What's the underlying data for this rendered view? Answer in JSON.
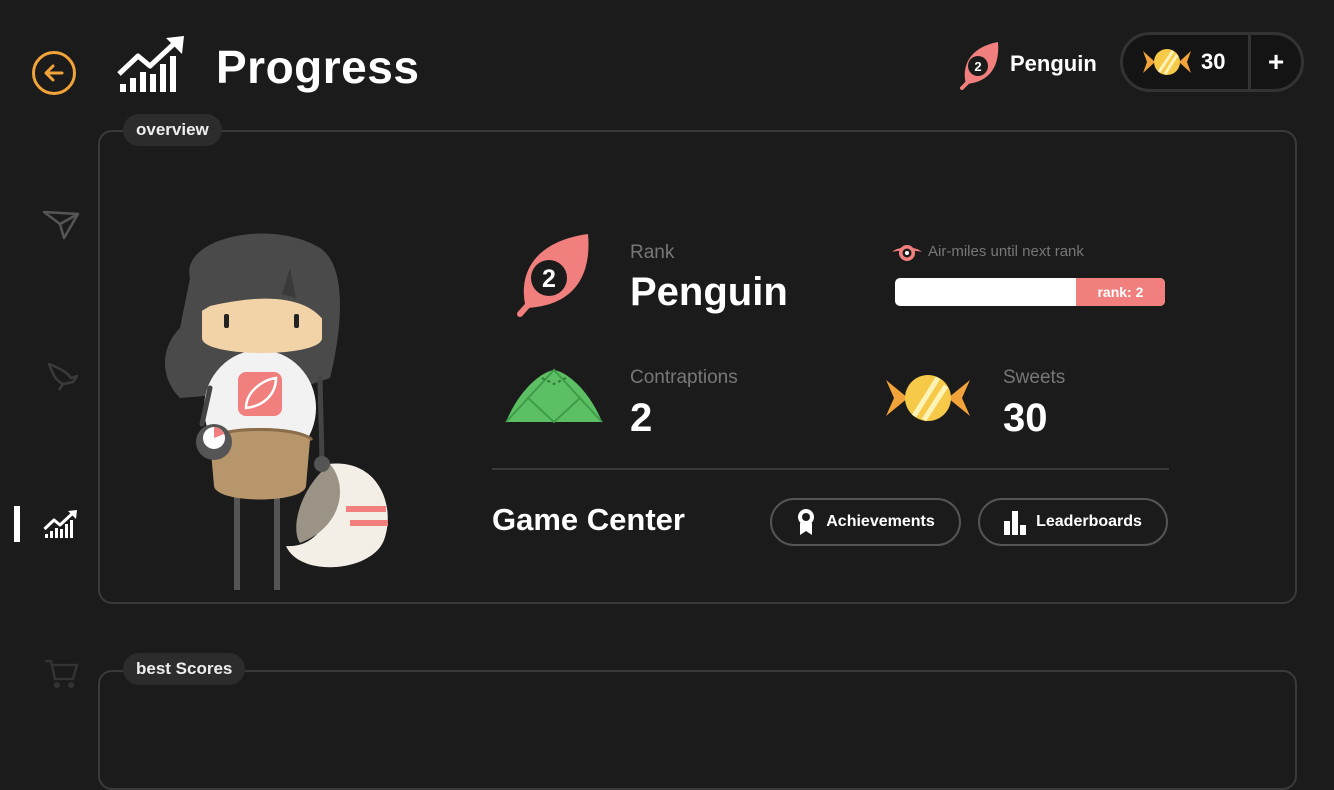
{
  "header": {
    "title": "Progress",
    "rank_number": "2",
    "rank_name": "Penguin",
    "sweets_count": "30",
    "add_label": "+"
  },
  "sidebar": {
    "items": [
      {
        "name": "paper-plane",
        "active": false
      },
      {
        "name": "bird",
        "active": false
      },
      {
        "name": "progress",
        "active": true
      },
      {
        "name": "shop",
        "active": false
      }
    ]
  },
  "overview": {
    "tag": "overview",
    "rank_label": "Rank",
    "rank_value": "Penguin",
    "rank_number": "2",
    "airmiles_label": "Air-miles until next rank",
    "airmiles_progress": 0.33,
    "airmiles_rank_label": "rank: 2",
    "contraptions_label": "Contraptions",
    "contraptions_value": "2",
    "sweets_label": "Sweets",
    "sweets_value": "30",
    "game_center_label": "Game Center",
    "achievements_label": "Achievements",
    "leaderboards_label": "Leaderboards"
  },
  "best_scores": {
    "tag": "best Scores"
  },
  "colors": {
    "accent_orange": "#f2a33a",
    "rank_pink": "#f07f7d",
    "contraption_green": "#5cbf63",
    "sweet_yellow": "#f7c948",
    "background": "#1b1b1b"
  }
}
